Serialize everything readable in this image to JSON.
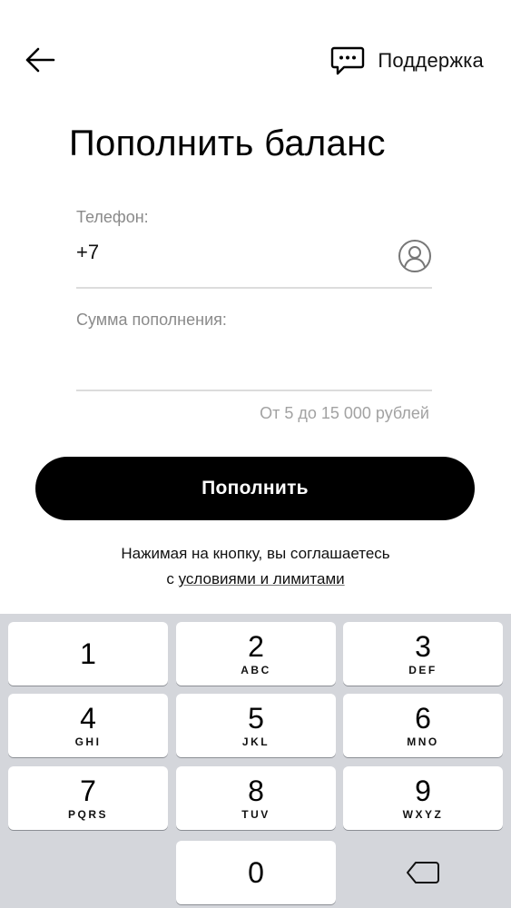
{
  "header": {
    "support_label": "Поддержка"
  },
  "title": "Пополнить баланс",
  "form": {
    "phone_label": "Телефон:",
    "phone_value": "+7",
    "amount_label": "Сумма пополнения:",
    "amount_value": "",
    "amount_hint": "От 5 до 15 000 рублей",
    "submit_label": "Пополнить"
  },
  "agreement": {
    "line1": "Нажимая на кнопку, вы соглашаетесь",
    "prefix": "с ",
    "link": "условиями и лимитами"
  },
  "keypad": {
    "keys": [
      {
        "digit": "1",
        "letters": ""
      },
      {
        "digit": "2",
        "letters": "ABC"
      },
      {
        "digit": "3",
        "letters": "DEF"
      },
      {
        "digit": "4",
        "letters": "GHI"
      },
      {
        "digit": "5",
        "letters": "JKL"
      },
      {
        "digit": "6",
        "letters": "MNO"
      },
      {
        "digit": "7",
        "letters": "PQRS"
      },
      {
        "digit": "8",
        "letters": "TUV"
      },
      {
        "digit": "9",
        "letters": "WXYZ"
      },
      {
        "digit": "0",
        "letters": ""
      }
    ],
    "backspace_icon": "backspace-icon"
  },
  "icons": {
    "back": "arrow-left-icon",
    "support": "chat-bubble-icon",
    "contact": "contact-icon"
  },
  "colors": {
    "primary": "#000000",
    "label_gray": "#8a8a8a",
    "keyboard_bg": "#d4d6db"
  }
}
